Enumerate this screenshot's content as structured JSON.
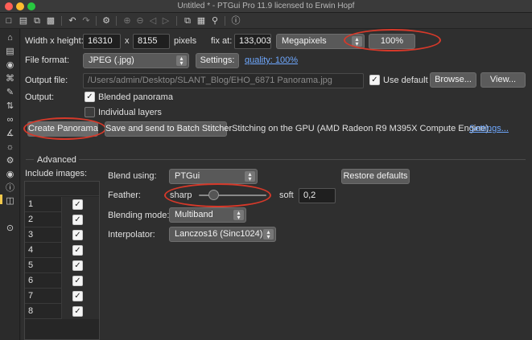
{
  "window": {
    "title": "Untitled * - PTGui Pro 11.9 licensed to Erwin Hopf"
  },
  "toolbar": {
    "icons": [
      "new-project-icon",
      "save-project-icon",
      "duplicate-icon",
      "save-icon",
      "undo-icon",
      "redo-icon",
      "settings-icon",
      "zoom-in-icon",
      "zoom-out-icon",
      "prev-icon",
      "next-icon",
      "panorama-editor-icon",
      "table-icon",
      "pin-icon",
      "help-icon"
    ]
  },
  "sidebar": {
    "icons": [
      "home-icon",
      "images-icon",
      "camera-icon",
      "crop-icon",
      "mask-icon",
      "adjust-icon",
      "control-points-icon",
      "optimizer-icon",
      "exposure-icon",
      "settings-icon",
      "preview-icon",
      "info-icon",
      "panorama-icon",
      "collapse-icon"
    ]
  },
  "size": {
    "label": "Width x height:",
    "width": "16310",
    "x": "x",
    "height": "8155",
    "unit": "pixels",
    "fix_label": "fix at:",
    "fix_value": "133,003",
    "fix_mode": "Megapixels",
    "percent": "100%"
  },
  "format": {
    "label": "File format:",
    "value": "JPEG (.jpg)",
    "settings": "Settings:",
    "quality": "quality: 100%"
  },
  "output_file": {
    "label": "Output file:",
    "path": "/Users/admin/Desktop/SLANT_Blog/EHO_6871 Panorama.jpg",
    "use_default": "Use default",
    "browse": "Browse...",
    "view": "View..."
  },
  "output": {
    "label": "Output:",
    "blended": "Blended panorama",
    "individual": "Individual layers"
  },
  "actions": {
    "create": "Create Panorama",
    "batch": "Save and send to Batch Stitcher",
    "gpu_info": "Stitching on the GPU (AMD Radeon R9 M395X Compute Engine).",
    "gpu_settings": "Settings..."
  },
  "advanced": {
    "title": "Advanced",
    "include_images": "Include images:",
    "images": [
      "1",
      "2",
      "3",
      "4",
      "5",
      "6",
      "7",
      "8"
    ],
    "blend_label": "Blend using:",
    "blend_value": "PTGui",
    "restore": "Restore defaults",
    "feather_label": "Feather:",
    "feather_sharp": "sharp",
    "feather_soft": "soft",
    "feather_value": "0,2",
    "mode_label": "Blending mode:",
    "mode_value": "Multiband",
    "interp_label": "Interpolator:",
    "interp_value": "Lanczos16 (Sinc1024)"
  },
  "colors": {
    "annotation": "#d6392a",
    "link": "#6ea8ff"
  }
}
